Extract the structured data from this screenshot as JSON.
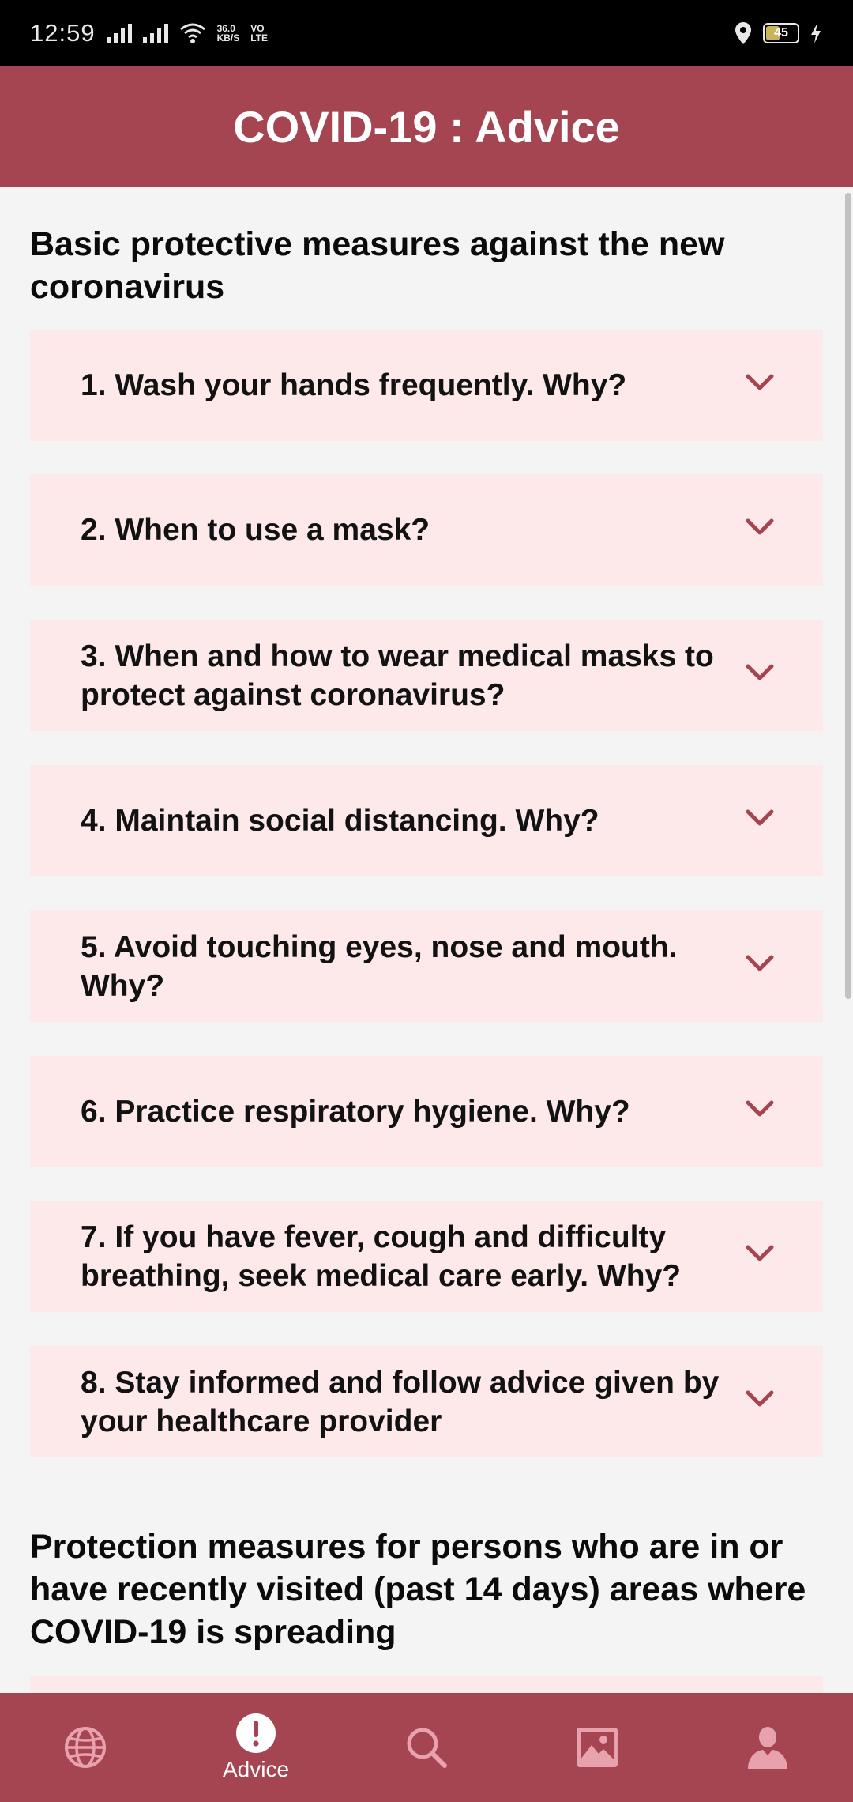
{
  "status_bar": {
    "time": "12:59",
    "net_speed_value": "36.0",
    "net_speed_unit": "KB/S",
    "volte_top": "VO",
    "volte_bottom": "LTE",
    "battery_level": "45"
  },
  "app_bar": {
    "title": "COVID-19 : Advice"
  },
  "sections": [
    {
      "title": "Basic protective measures against the new coronavirus",
      "items": [
        {
          "label": "1. Wash your hands frequently. Why?"
        },
        {
          "label": "2. When to use a mask?"
        },
        {
          "label": "3. When and how to wear medical masks to protect against coronavirus?"
        },
        {
          "label": "4. Maintain social distancing. Why?"
        },
        {
          "label": "5. Avoid touching eyes, nose and mouth. Why?"
        },
        {
          "label": "6. Practice respiratory hygiene. Why?"
        },
        {
          "label": "7. If you have fever, cough and difficulty breathing, seek medical care early. Why?"
        },
        {
          "label": "8. Stay informed and follow advice given by your healthcare provider"
        }
      ]
    },
    {
      "title": "Protection measures for persons who are in or have recently visited (past 14 days) areas where COVID-19 is spreading"
    }
  ],
  "bottom_nav": {
    "items": [
      {
        "icon": "globe-icon",
        "label": ""
      },
      {
        "icon": "alert-icon",
        "label": "Advice",
        "active": true
      },
      {
        "icon": "search-icon",
        "label": ""
      },
      {
        "icon": "image-icon",
        "label": ""
      },
      {
        "icon": "person-icon",
        "label": ""
      }
    ]
  },
  "colors": {
    "primary": "#a54552",
    "card_background": "#fde8ea",
    "chevron": "#a54552",
    "page_background": "#f4f4f4"
  }
}
